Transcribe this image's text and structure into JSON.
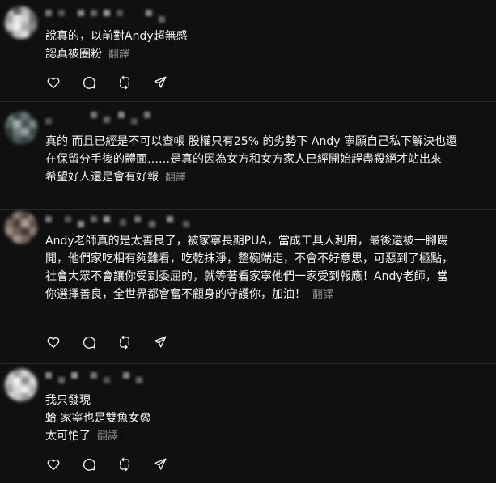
{
  "colors": {
    "background": "#101010",
    "text": "#f3f5f7",
    "muted": "#8d8d8d",
    "divider": "#2a2a2a"
  },
  "icons": [
    "heart-icon",
    "comment-icon",
    "repost-icon",
    "share-icon"
  ],
  "posts": [
    {
      "lines": [
        "說真的，以前對Andy超無感",
        "認真被圈粉"
      ],
      "translate": "翻譯"
    },
    {
      "lines": [
        "真的 而且已經是不可以查帳 股權只有25% 的劣勢下 Andy 寧願自己私下解決也還",
        "在保留分手後的體面……是真的因為女方和女方家人已經開始趕盡殺絕才站出來",
        "希望好人還是會有好報"
      ],
      "translate": "翻譯"
    },
    {
      "lines": [
        "Andy老師真的是太善良了，被家寧長期PUA，當成工具人利用，最後還被一腳踢",
        "開，他們家吃相有夠難看，吃乾抹淨，整碗端走，不會不好意思，可惡到了極點，",
        "社會大眾不會讓你受到委屈的，就等著看家寧他們一家受到報應！Andy老師，當",
        "你選擇善良，全世界都會奮不顧身的守護你，加油！"
      ],
      "translate": "翻譯"
    },
    {
      "lines": [
        "我只發現",
        "蛤 家寧也是雙魚女😨",
        "太可怕了"
      ],
      "translate": "翻譯"
    }
  ]
}
